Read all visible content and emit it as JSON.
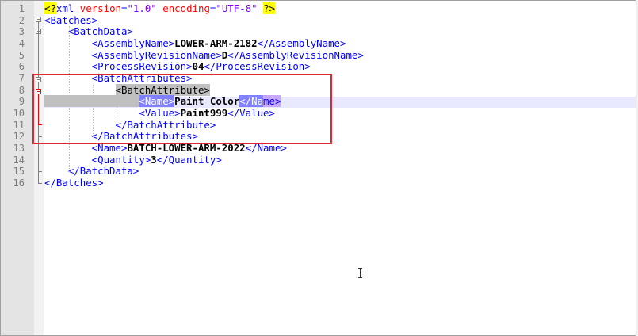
{
  "editor": {
    "line_numbers": [
      "1",
      "2",
      "3",
      "4",
      "5",
      "6",
      "7",
      "8",
      "9",
      "10",
      "11",
      "12",
      "13",
      "14",
      "15",
      "16"
    ],
    "lines": [
      {
        "parts": [
          [
            "pi",
            "<?"
          ],
          [
            "tag",
            "xml "
          ],
          [
            "attr",
            "version"
          ],
          [
            "tag",
            "="
          ],
          [
            "val",
            "\"1.0\""
          ],
          [
            "tag",
            " "
          ],
          [
            "attr",
            "encoding"
          ],
          [
            "tag",
            "="
          ],
          [
            "val",
            "\"UTF-8\""
          ],
          [
            "tag",
            " "
          ],
          [
            "pi",
            "?>"
          ]
        ]
      },
      {
        "parts": [
          [
            "tag",
            "<Batches>"
          ]
        ]
      },
      {
        "parts": [
          [
            "tag",
            "    <BatchData>"
          ]
        ]
      },
      {
        "parts": [
          [
            "tag",
            "        <AssemblyName>"
          ],
          [
            "txt",
            "LOWER-ARM-2182"
          ],
          [
            "tag",
            "</AssemblyName>"
          ]
        ]
      },
      {
        "parts": [
          [
            "tag",
            "        <AssemblyRevisionName>"
          ],
          [
            "txt",
            "D"
          ],
          [
            "tag",
            "</AssemblyRevisionName>"
          ]
        ]
      },
      {
        "parts": [
          [
            "tag",
            "        <ProcessRevision>"
          ],
          [
            "txt",
            "04"
          ],
          [
            "tag",
            "</ProcessRevision>"
          ]
        ]
      },
      {
        "parts": [
          [
            "tag",
            "        <BatchAttributes>"
          ]
        ]
      },
      {
        "parts": [
          [
            "tag",
            "            "
          ],
          [
            "sel",
            "<BatchAttribute>"
          ]
        ]
      },
      {
        "parts": [
          [
            "sel",
            "                "
          ],
          [
            "hlbrace",
            "<Name>"
          ],
          [
            "txt",
            "Paint Color"
          ],
          [
            "hlbrace",
            "</Na"
          ],
          [
            "hlbrace2",
            "me>"
          ]
        ]
      },
      {
        "parts": [
          [
            "tag",
            "                <Value>"
          ],
          [
            "txt",
            "Paint999"
          ],
          [
            "tag",
            "</Value>"
          ]
        ]
      },
      {
        "parts": [
          [
            "tag",
            "            </BatchAttribute>"
          ]
        ]
      },
      {
        "parts": [
          [
            "tag",
            "        </BatchAttributes>"
          ]
        ]
      },
      {
        "parts": [
          [
            "tag",
            "        <Name>"
          ],
          [
            "txt",
            "BATCH-LOWER-ARM-2022"
          ],
          [
            "tag",
            "</Name>"
          ]
        ]
      },
      {
        "parts": [
          [
            "tag",
            "        <Quantity>"
          ],
          [
            "txt",
            "3"
          ],
          [
            "tag",
            "</Quantity>"
          ]
        ]
      },
      {
        "parts": [
          [
            "tag",
            "    </BatchData>"
          ]
        ]
      },
      {
        "parts": [
          [
            "tag",
            "</Batches>"
          ]
        ]
      }
    ],
    "current_line": 9,
    "cursor_icon": "text-cursor-icon"
  }
}
